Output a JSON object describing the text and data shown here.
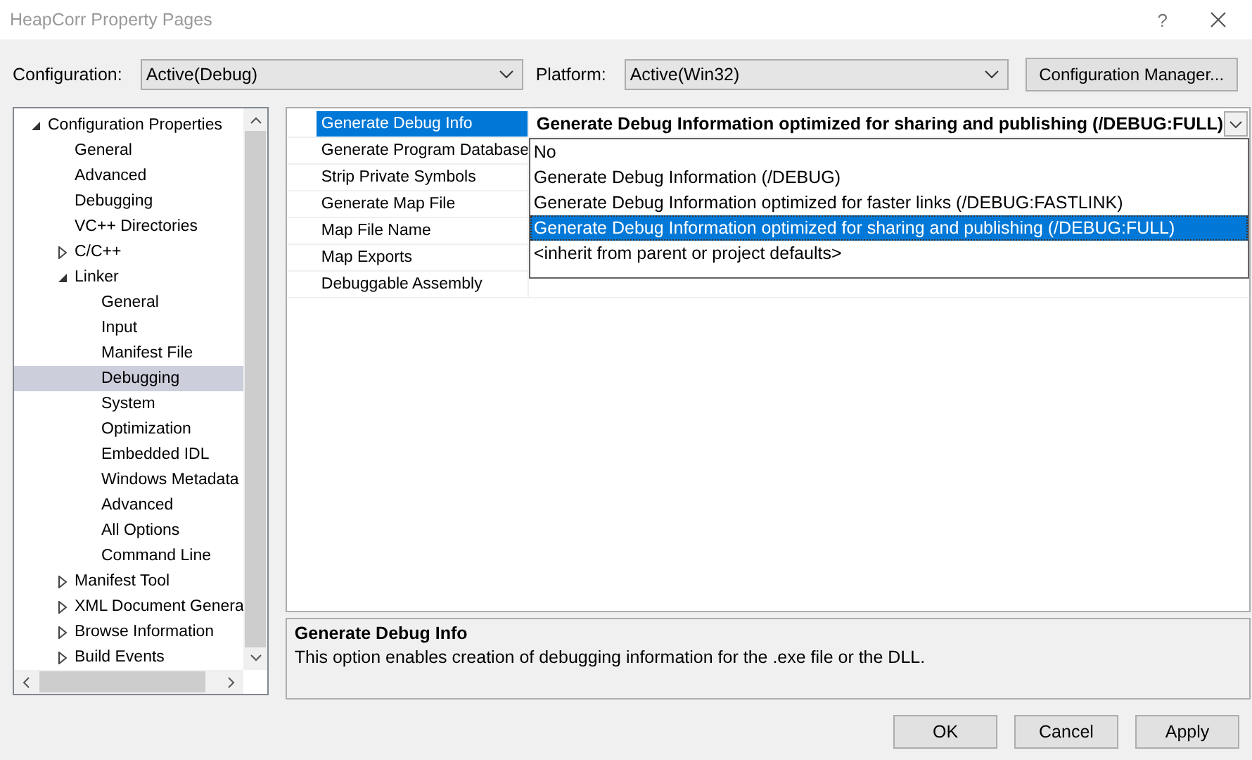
{
  "window": {
    "title": "HeapCorr Property Pages",
    "help": "?"
  },
  "toolbar": {
    "configuration_label": "Configuration:",
    "configuration": "Active(Debug)",
    "platform_label": "Platform:",
    "platform": "Active(Win32)",
    "manager_button": "Configuration Manager..."
  },
  "tree": [
    {
      "label": "Configuration Properties",
      "expanded": true,
      "selected": false,
      "children": [
        {
          "label": "General",
          "selected": false
        },
        {
          "label": "Advanced",
          "selected": false
        },
        {
          "label": "Debugging",
          "selected": false
        },
        {
          "label": "VC++ Directories",
          "selected": false
        },
        {
          "label": "C/C++",
          "expanded": false,
          "selected": false
        },
        {
          "label": "Linker",
          "expanded": true,
          "selected": false,
          "children": [
            {
              "label": "General",
              "selected": false
            },
            {
              "label": "Input",
              "selected": false
            },
            {
              "label": "Manifest File",
              "selected": false
            },
            {
              "label": "Debugging",
              "selected": true
            },
            {
              "label": "System",
              "selected": false
            },
            {
              "label": "Optimization",
              "selected": false
            },
            {
              "label": "Embedded IDL",
              "selected": false
            },
            {
              "label": "Windows Metadata",
              "selected": false
            },
            {
              "label": "Advanced",
              "selected": false
            },
            {
              "label": "All Options",
              "selected": false
            },
            {
              "label": "Command Line",
              "selected": false
            }
          ]
        },
        {
          "label": "Manifest Tool",
          "expanded": false,
          "selected": false
        },
        {
          "label": "XML Document Genera",
          "expanded": false,
          "selected": false
        },
        {
          "label": "Browse Information",
          "expanded": false,
          "selected": false
        },
        {
          "label": "Build Events",
          "expanded": false,
          "selected": false
        }
      ]
    }
  ],
  "properties": [
    {
      "name": "Generate Debug Info",
      "value": "Generate Debug Information optimized for sharing and publishing (/DEBUG:FULL)",
      "selected": true
    },
    {
      "name": "Generate Program Database",
      "selected": false
    },
    {
      "name": "Strip Private Symbols",
      "selected": false
    },
    {
      "name": "Generate Map File",
      "selected": false
    },
    {
      "name": "Map File Name",
      "selected": false
    },
    {
      "name": "Map Exports",
      "selected": false
    },
    {
      "name": "Debuggable Assembly",
      "selected": false
    }
  ],
  "dropdown_options": [
    {
      "label": "No",
      "selected": false
    },
    {
      "label": "Generate Debug Information (/DEBUG)",
      "selected": false
    },
    {
      "label": "Generate Debug Information optimized for faster links (/DEBUG:FASTLINK)",
      "selected": false
    },
    {
      "label": "Generate Debug Information optimized for sharing and publishing (/DEBUG:FULL)",
      "selected": true
    },
    {
      "label": "<inherit from parent or project defaults>",
      "selected": false
    }
  ],
  "description": {
    "title": "Generate Debug Info",
    "text": "This option enables creation of debugging information for the .exe file or the DLL."
  },
  "buttons": [
    "OK",
    "Cancel",
    "Apply"
  ]
}
